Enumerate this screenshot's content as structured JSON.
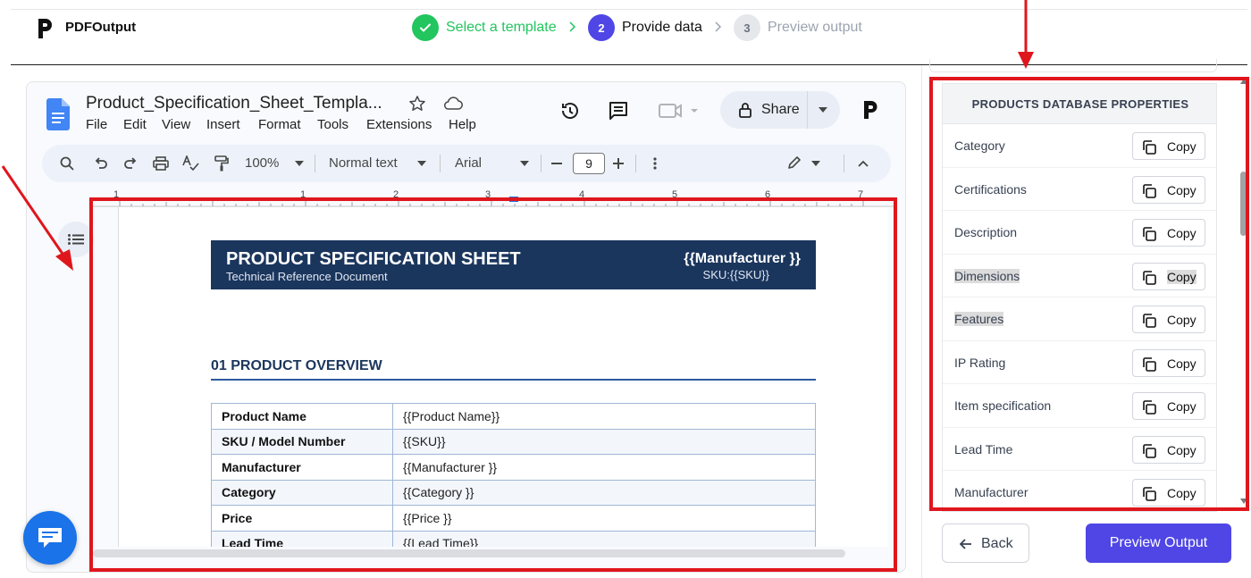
{
  "app": {
    "name": "PDFOutput"
  },
  "steps": [
    {
      "label": "Select a template",
      "state": "done"
    },
    {
      "number": "2",
      "label": "Provide data",
      "state": "active"
    },
    {
      "number": "3",
      "label": "Preview output",
      "state": "pending"
    }
  ],
  "gdoc": {
    "title": "Product_Specification_Sheet_Templa...",
    "menu": [
      "File",
      "Edit",
      "View",
      "Insert",
      "Format",
      "Tools",
      "Extensions",
      "Help"
    ],
    "share_label": "Share",
    "toolbar": {
      "zoom": "100%",
      "style": "Normal text",
      "font": "Arial",
      "font_size": "9"
    },
    "ruler_numbers": [
      "1",
      "1",
      "2",
      "3",
      "4",
      "5",
      "6",
      "7"
    ]
  },
  "document": {
    "banner_title": "PRODUCT SPECIFICATION SHEET",
    "banner_subtitle": "Technical Reference Document",
    "banner_manufacturer": "{{Manufacturer }}",
    "banner_sku": "SKU:{{SKU}}",
    "section_title": "01  PRODUCT OVERVIEW",
    "rows": [
      {
        "key": "Product Name",
        "value": "{{Product Name}}"
      },
      {
        "key": "SKU / Model Number",
        "value": "{{SKU}}"
      },
      {
        "key": "Manufacturer",
        "value": "{{Manufacturer }}"
      },
      {
        "key": "Category",
        "value": "{{Category }}"
      },
      {
        "key": "Price",
        "value": "{{Price }}"
      },
      {
        "key": "Lead Time",
        "value": "{{Lead Time}}"
      }
    ]
  },
  "panel": {
    "header": "PRODUCTS DATABASE PROPERTIES",
    "copy_label": "Copy",
    "properties": [
      "Category",
      "Certifications",
      "Description",
      "Dimensions",
      "Features",
      "IP Rating",
      "Item specification",
      "Lead Time",
      "Manufacturer"
    ]
  },
  "footer": {
    "back_label": "Back",
    "preview_label": "Preview Output"
  },
  "colors": {
    "accent": "#4f46e5",
    "success": "#22c55e",
    "banner": "#1b365d",
    "annotation": "#e0161d"
  }
}
